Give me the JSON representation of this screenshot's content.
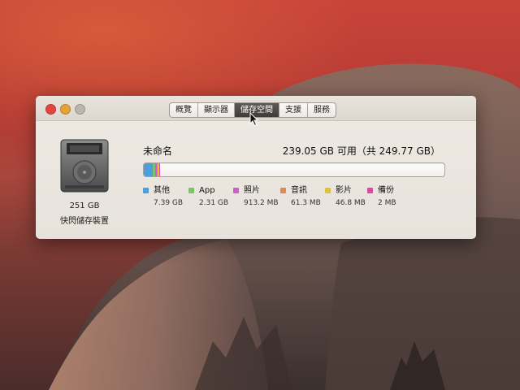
{
  "window": {
    "tabs": [
      {
        "label": "概覽",
        "active": false
      },
      {
        "label": "顯示器",
        "active": false
      },
      {
        "label": "儲存空間",
        "active": true
      },
      {
        "label": "支援",
        "active": false
      },
      {
        "label": "服務",
        "active": false
      }
    ]
  },
  "drive": {
    "size": "251 GB",
    "name": "快閃儲存裝置",
    "icon": "flash-drive-icon"
  },
  "volume": {
    "name": "未命名",
    "capacity": "239.05 GB 可用（共 249.77 GB）"
  },
  "storage": {
    "total_gb": 249.77,
    "free_gb": 239.05,
    "categories": [
      {
        "label": "其他",
        "size": "7.39 GB",
        "gb": 7.39,
        "color": "#4a9fdc"
      },
      {
        "label": "App",
        "size": "2.31 GB",
        "gb": 2.31,
        "color": "#7dc36b"
      },
      {
        "label": "照片",
        "size": "913.2 MB",
        "gb": 0.9132,
        "color": "#d25bd0"
      },
      {
        "label": "音訊",
        "size": "61.3 MB",
        "gb": 0.0613,
        "color": "#e08a4f"
      },
      {
        "label": "影片",
        "size": "46.8 MB",
        "gb": 0.0468,
        "color": "#dcc33a"
      },
      {
        "label": "備份",
        "size": "2 MB",
        "gb": 0.002,
        "color": "#d94aa2"
      }
    ]
  }
}
